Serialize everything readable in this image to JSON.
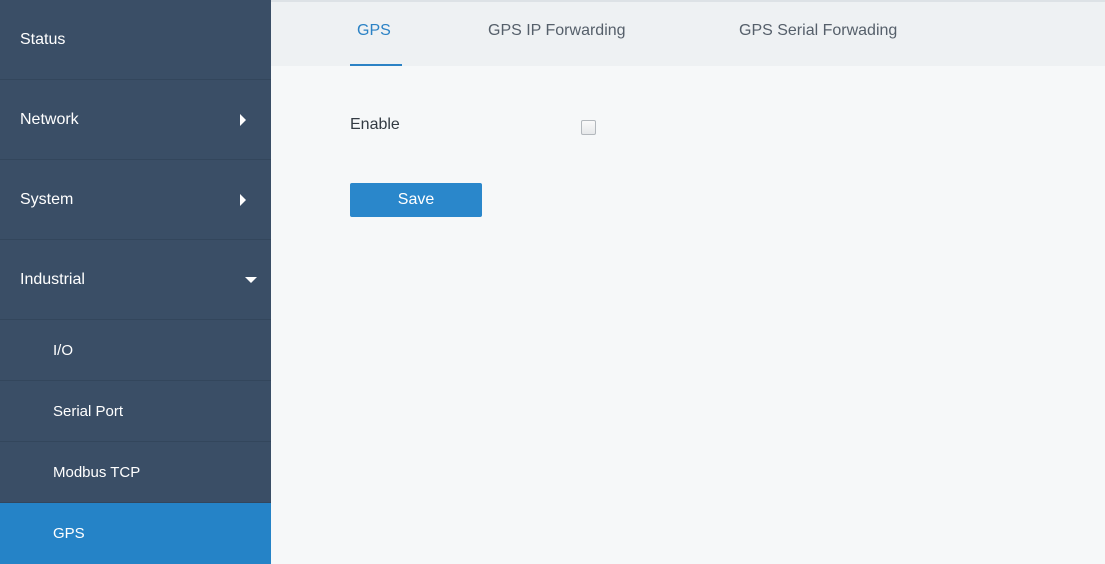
{
  "sidebar": {
    "items": [
      {
        "label": "Status"
      },
      {
        "label": "Network",
        "icon": "chevron-right-icon"
      },
      {
        "label": "System",
        "icon": "chevron-right-icon"
      },
      {
        "label": "Industrial",
        "icon": "chevron-down-icon"
      }
    ],
    "subitems": [
      {
        "label": "I/O"
      },
      {
        "label": "Serial Port"
      },
      {
        "label": "Modbus TCP"
      },
      {
        "label": "GPS",
        "active": true
      }
    ]
  },
  "tabs": [
    {
      "label": "GPS",
      "active": true
    },
    {
      "label": "GPS IP Forwarding"
    },
    {
      "label": "GPS Serial Forwading"
    }
  ],
  "form": {
    "enable_label": "Enable",
    "enable_checked": false,
    "save_label": "Save"
  },
  "colors": {
    "sidebar_bg": "#3a4e66",
    "active_bg": "#2583c7",
    "accent": "#2b82c5",
    "content_bg": "#f6f8f9"
  }
}
